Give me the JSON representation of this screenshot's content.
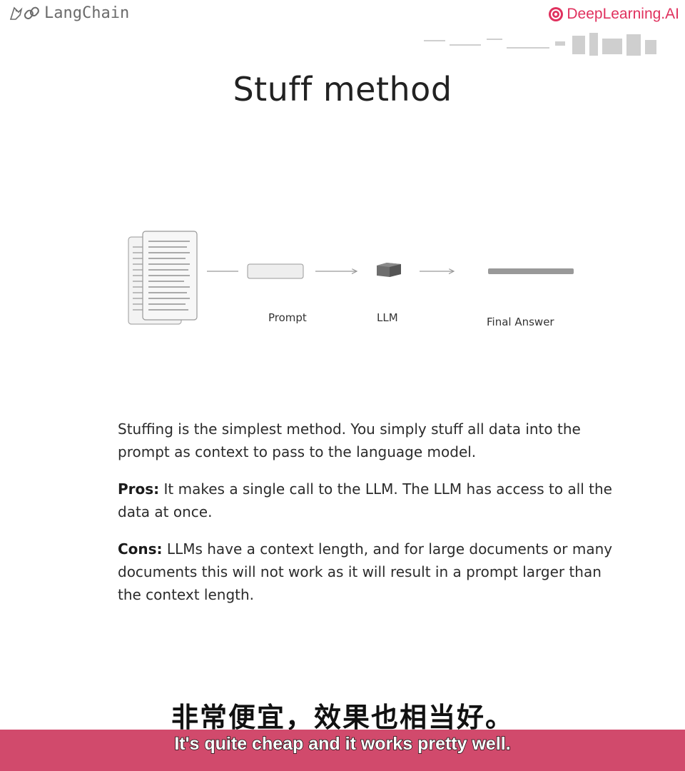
{
  "header": {
    "left_brand": "LangChain",
    "right_brand": "DeepLearning.AI",
    "brand_color": "#e0315e"
  },
  "slide": {
    "title": "Stuff method",
    "diagram": {
      "prompt_label": "Prompt",
      "llm_label": "LLM",
      "final_answer_label": "Final Answer"
    },
    "paragraphs": {
      "intro": "Stuffing is the simplest method. You simply stuff all data into the prompt as context to pass to the language model.",
      "pros_label": "Pros:",
      "pros_text": " It makes a single call to the LLM. The LLM has access to all the data at once.",
      "cons_label": "Cons:",
      "cons_text": " LLMs have a context length, and for large documents or many documents this will not work as it will result in a prompt larger than the context length."
    }
  },
  "subtitles": {
    "chinese": "非常便宜，效果也相当好。",
    "english": "It's quite cheap and it works pretty well.",
    "bar_color": "#d14a6c"
  }
}
